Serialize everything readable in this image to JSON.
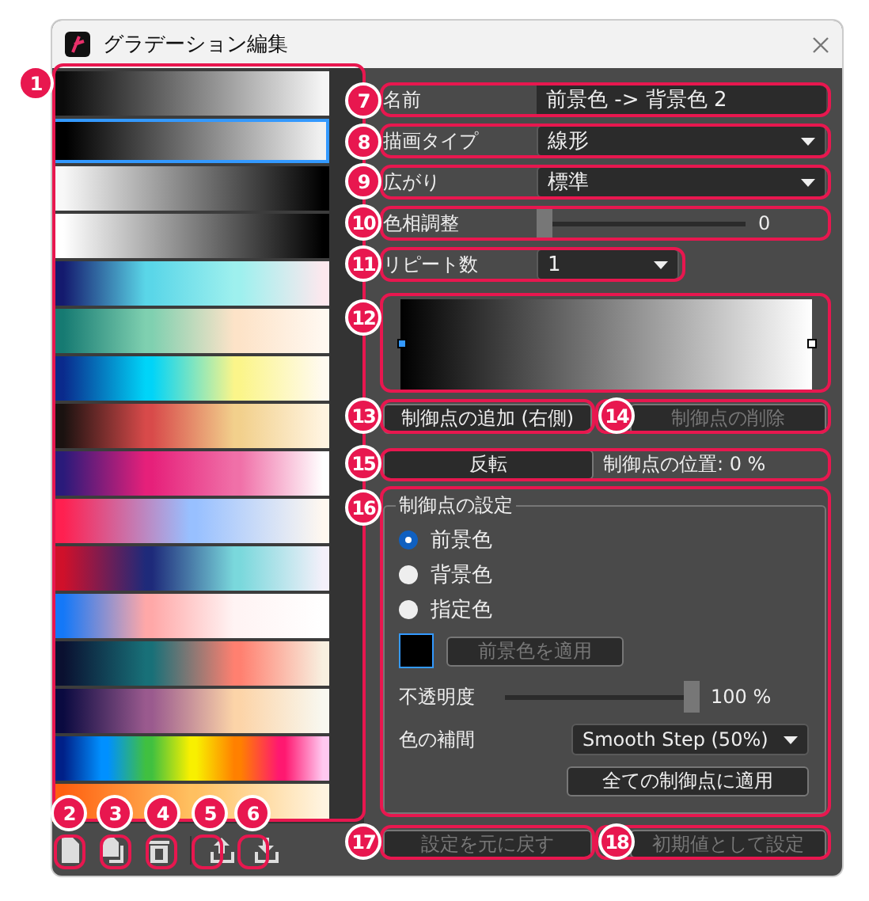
{
  "window": {
    "title": "グラデーション編集"
  },
  "gradients": [
    {
      "selected": false,
      "stops": [
        {
          "color": "#0a0a0a"
        },
        {
          "color": "#f5f5f5"
        }
      ]
    },
    {
      "selected": true,
      "stops": [
        {
          "color": "#000000"
        },
        {
          "color": "#f0f0f0"
        }
      ]
    },
    {
      "selected": false,
      "stops": [
        {
          "color": "#f8f8f8"
        },
        {
          "color": "#000000"
        }
      ]
    },
    {
      "selected": false,
      "stops": [
        {
          "color": "#ffffff"
        },
        {
          "color": "#000000"
        }
      ]
    },
    {
      "selected": false,
      "stops": [
        {
          "color": "#141a6e"
        },
        {
          "color": "#5ad6e8"
        },
        {
          "color": "#9ef0ee"
        },
        {
          "color": "#fde8ee"
        }
      ]
    },
    {
      "selected": false,
      "stops": [
        {
          "color": "#167a72"
        },
        {
          "color": "#7fd0b0"
        },
        {
          "color": "#fde3c8"
        },
        {
          "color": "#fff8f0"
        }
      ]
    },
    {
      "selected": false,
      "stops": [
        {
          "color": "#0a2a8c"
        },
        {
          "color": "#00d4f8"
        },
        {
          "color": "#fbf58a"
        },
        {
          "color": "#fffaf0"
        }
      ]
    },
    {
      "selected": false,
      "stops": [
        {
          "color": "#1a1210"
        },
        {
          "color": "#d84a4a"
        },
        {
          "color": "#f2d08c"
        },
        {
          "color": "#fff4e0"
        }
      ]
    },
    {
      "selected": false,
      "stops": [
        {
          "color": "#2a1a7a"
        },
        {
          "color": "#e6207a"
        },
        {
          "color": "#f070a8"
        },
        {
          "color": "#ffffff"
        }
      ]
    },
    {
      "selected": false,
      "stops": [
        {
          "color": "#ff2050"
        },
        {
          "color": "#98c0ff"
        },
        {
          "color": "#fff8f0"
        }
      ]
    },
    {
      "selected": false,
      "stops": [
        {
          "color": "#d0102a"
        },
        {
          "color": "#1e2a7a"
        },
        {
          "color": "#7ad8dc"
        },
        {
          "color": "#f4f0fa"
        }
      ]
    },
    {
      "selected": false,
      "stops": [
        {
          "color": "#1478f8"
        },
        {
          "color": "#ffa8a8"
        },
        {
          "color": "#fff4f4"
        },
        {
          "color": "#ffffff"
        }
      ]
    },
    {
      "selected": false,
      "stops": [
        {
          "color": "#0a1030"
        },
        {
          "color": "#187078"
        },
        {
          "color": "#ff8070"
        },
        {
          "color": "#f8f0e0"
        }
      ]
    },
    {
      "selected": false,
      "stops": [
        {
          "color": "#0a0a40"
        },
        {
          "color": "#9a5a8e"
        },
        {
          "color": "#fcd4a8"
        },
        {
          "color": "#f8f8f0"
        }
      ]
    },
    {
      "selected": false,
      "stops": [
        {
          "color": "#002088"
        },
        {
          "color": "#0090ff"
        },
        {
          "color": "#40c040"
        },
        {
          "color": "#f8f000"
        },
        {
          "color": "#ff8000"
        },
        {
          "color": "#ff1870"
        },
        {
          "color": "#ffc8f0"
        }
      ]
    },
    {
      "selected": false,
      "stops": [
        {
          "color": "#ff6010"
        },
        {
          "color": "#ffc060"
        },
        {
          "color": "#fff4e0"
        }
      ]
    }
  ],
  "name": {
    "label": "名前",
    "value": "前景色 -> 背景色 2"
  },
  "draw_type": {
    "label": "描画タイプ",
    "value": "線形"
  },
  "spread": {
    "label": "広がり",
    "value": "標準"
  },
  "hue": {
    "label": "色相調整",
    "level": 0,
    "reading": "0"
  },
  "repeat": {
    "label": "リピート数",
    "value": "1"
  },
  "preview": {
    "stops": [
      {
        "selected": true
      },
      {
        "selected": false
      }
    ]
  },
  "point_buttons": [
    {
      "label": "制御点の追加 (右側)",
      "disabled": false
    },
    {
      "label": "制御点の削除",
      "disabled": true
    }
  ],
  "reverse_button": {
    "label": "反転"
  },
  "position": "制御点の位置: 0 %",
  "stop_settings": {
    "title": "制御点の設定",
    "options": [
      {
        "label": "前景色",
        "selected": true
      },
      {
        "label": "背景色",
        "selected": false
      },
      {
        "label": "指定色",
        "selected": false
      }
    ],
    "apply_button": {
      "label": "前景色を適用",
      "disabled": true
    },
    "opacity": {
      "label": "不透明度",
      "level": 1,
      "reading": "100 %"
    },
    "interpolation": {
      "label": "色の補間",
      "value": "Smooth Step (50%)"
    },
    "apply_all_button": {
      "label": "全ての制御点に適用",
      "disabled": false
    }
  },
  "footer_buttons": [
    {
      "label": "設定を元に戻す",
      "disabled": true
    },
    {
      "label": "初期値として設定",
      "disabled": true
    }
  ],
  "callouts": [
    "1",
    "2",
    "3",
    "4",
    "5",
    "6",
    "7",
    "8",
    "9",
    "10",
    "11",
    "12",
    "13",
    "14",
    "15",
    "16",
    "17",
    "18"
  ]
}
